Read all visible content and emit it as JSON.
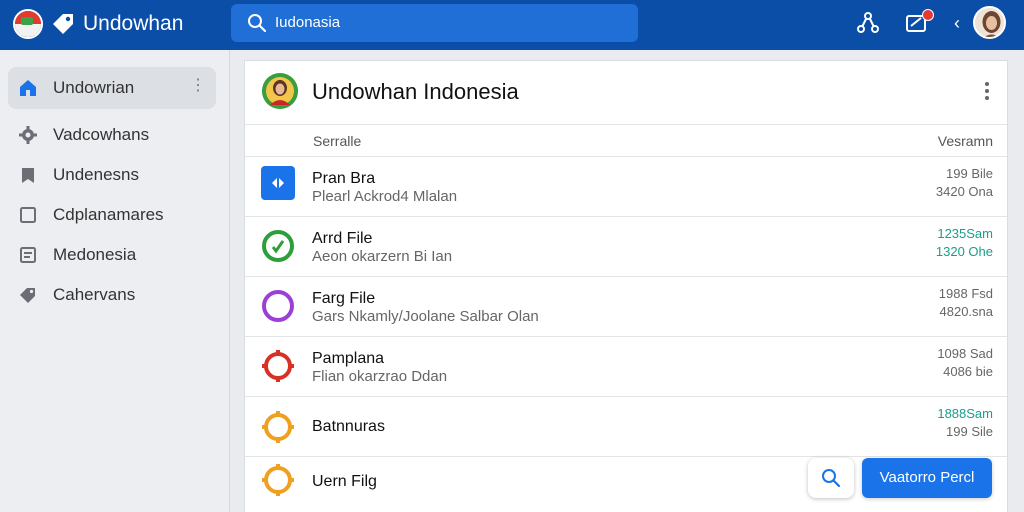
{
  "app": {
    "title": "Undowhan"
  },
  "search": {
    "value": "Iudonasia"
  },
  "topbar": {
    "icons": [
      "share-network-icon",
      "compose-mail-icon",
      "chevron-left-icon",
      "user-avatar"
    ]
  },
  "sidebar": {
    "items": [
      {
        "label": "Undowrian",
        "icon": "home-icon",
        "active": true
      },
      {
        "label": "Vadcowhans",
        "icon": "gear-icon",
        "active": false
      },
      {
        "label": "Undenesns",
        "icon": "bookmark-icon",
        "active": false
      },
      {
        "label": "Cdplanamares",
        "icon": "square-icon",
        "active": false
      },
      {
        "label": "Medonesia",
        "icon": "list-box-icon",
        "active": false
      },
      {
        "label": "Cahervans",
        "icon": "tag-icon",
        "active": false
      }
    ]
  },
  "panel": {
    "title": "Undowhan Indonesia",
    "columns": {
      "left": "Serralle",
      "right": "Vesramn"
    },
    "rows": [
      {
        "title": "Pran Bra",
        "subtitle": "Plearl Ackrod4 Mlalan",
        "value1": "199 Bile",
        "value2": "3420 Ona",
        "value_color": "#666666",
        "icon": "blue-square-arrows-icon"
      },
      {
        "title": "Arrd File",
        "subtitle": "Aeon okarzern Bi Ian",
        "value1": "1235Sam",
        "value2": "1320 Ohe",
        "value_color": "#1a9e8a",
        "icon": "green-ring-icon"
      },
      {
        "title": "Farg File",
        "subtitle": "Gars Nkamly/Joolane Salbar Olan",
        "value1": "1988 Fsd",
        "value2": "4820.sna",
        "value_color": "#666666",
        "icon": "purple-ring-icon"
      },
      {
        "title": "Pamplana",
        "subtitle": "Flian okarzrao Ddan",
        "value1": "1098 Sad",
        "value2": "4086 bie",
        "value_color": "#666666",
        "icon": "red-gear-icon"
      },
      {
        "title": "Batnnuras",
        "subtitle": "",
        "value1": "1888Sam",
        "value2": "199 Sile",
        "value_color": "#1a9e8a",
        "icon": "orange-gear-icon"
      },
      {
        "title": "Uern Filg",
        "subtitle": "",
        "value1": "",
        "value2": "",
        "value_color": "#666666",
        "icon": "orange-gear-icon"
      }
    ]
  },
  "actions": {
    "primary_label": "Vaatorro Percl"
  },
  "colors": {
    "topbar": "#0b4ea8",
    "search": "#1f6fd6",
    "primary": "#1a73e8",
    "accent_teal": "#1a9e8a"
  }
}
